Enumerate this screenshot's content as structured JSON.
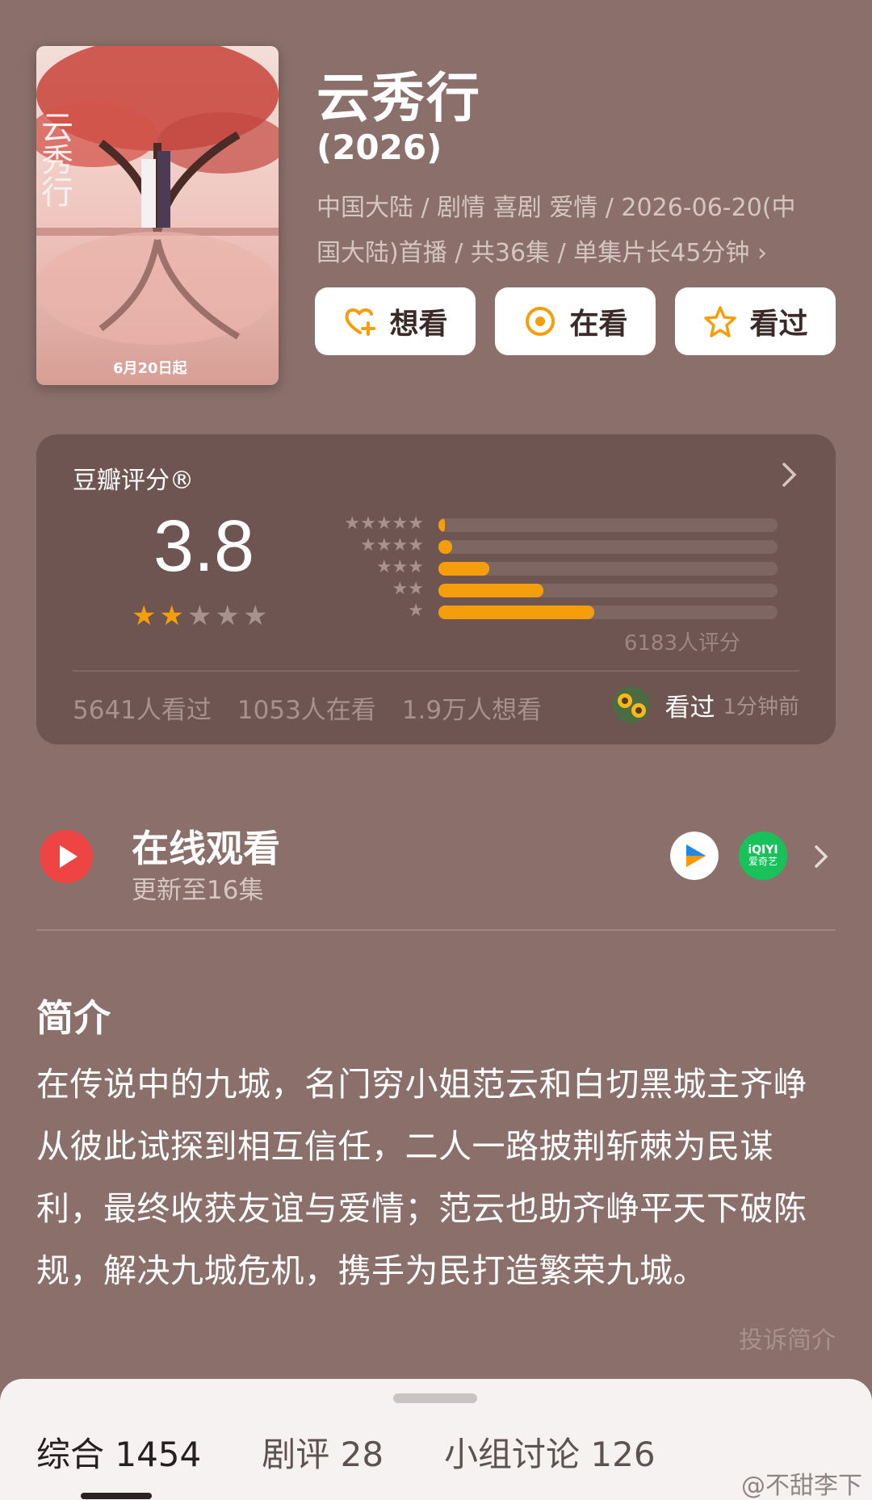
{
  "show": {
    "title": "云秀行",
    "year": "(2026)",
    "meta_line1": "中国大陆 / 剧情 喜剧 爱情 / 2026-06-20(中",
    "meta_line2": "国大陆)首播 / 共36集 / 单集片长45分钟 ›",
    "poster_text": "6月20日起",
    "poster_title": "云秀行"
  },
  "actions": {
    "want": "想看",
    "watching": "在看",
    "watched": "看过"
  },
  "rating": {
    "header": "豆瓣评分®",
    "score": "3.8",
    "score_stars": 2,
    "distribution": [
      {
        "stars": "★★★★★",
        "percent": 2
      },
      {
        "stars": "★★★★",
        "percent": 4
      },
      {
        "stars": "★★★",
        "percent": 15
      },
      {
        "stars": "★★",
        "percent": 31
      },
      {
        "stars": "★",
        "percent": 46
      }
    ],
    "total_votes": "6183人评分",
    "count_watched": "5641人看过",
    "count_watching": "1053人在看",
    "count_want": "1.9万人想看",
    "recent_status": "看过",
    "recent_time": "1分钟前"
  },
  "watch": {
    "title": "在线观看",
    "subtitle": "更新至16集",
    "iqiyi_top": "iQIYI",
    "iqiyi_bottom": "爱奇艺"
  },
  "intro": {
    "title": "简介",
    "body": "在传说中的九城，名门穷小姐范云和白切黑城主齐峥从彼此试探到相互信任，二人一路披荆斩棘为民谋利，最终收获友谊与爱情；范云也助齐峥平天下破陈规，解决九城危机，携手为民打造繁荣九城。",
    "report": "投诉简介"
  },
  "tabs": [
    {
      "label": "综合 1454"
    },
    {
      "label": "剧评 28"
    },
    {
      "label": "小组讨论 126"
    }
  ],
  "watermark": "@不甜李下",
  "colors": {
    "background": "#8a6f6a",
    "card": "#6e5551",
    "star": "#f59e0b",
    "accent_play": "#ef4444"
  }
}
